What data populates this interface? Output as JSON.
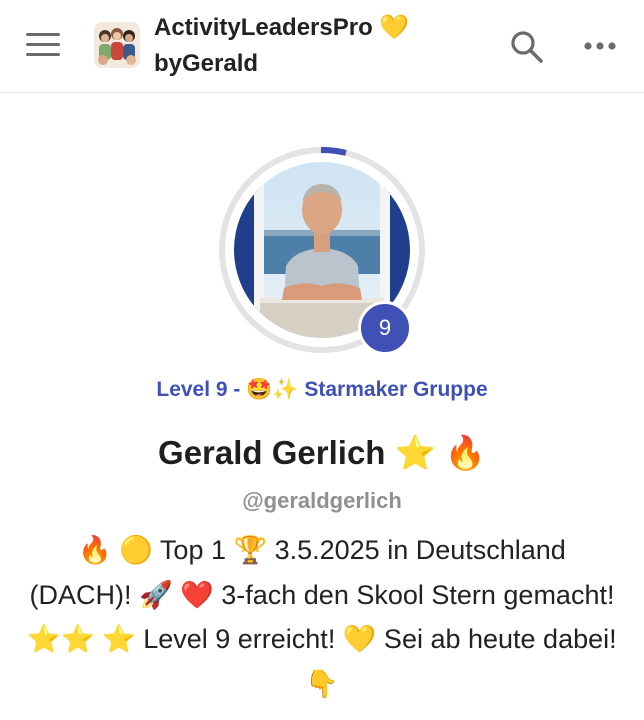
{
  "header": {
    "menu_icon": "hamburger-menu-icon",
    "group_name_line1": "ActivityLeadersPro 💛",
    "group_name_line2": "byGerald",
    "search_icon": "search-icon",
    "more_icon": "more-dots-icon"
  },
  "profile": {
    "level_badge": "9",
    "level_progress_fraction": 0.04,
    "level_label": "Level 9 - 🤩✨ Starmaker Gruppe",
    "name": "Gerald Gerlich ⭐ 🔥",
    "handle": "@geraldgerlich",
    "bio": "🔥 🟡 Top 1 🏆 3.5.2025 in Deutschland (DACH)! 🚀 ❤️ 3-fach den Skool Stern gemacht!⭐⭐ ⭐ Level 9 erreicht! 💛 Sei ab heute dabei! 👇"
  },
  "colors": {
    "accent": "#3f51b5",
    "ring_track": "#e3e3e3",
    "handle_gray": "#909090"
  }
}
